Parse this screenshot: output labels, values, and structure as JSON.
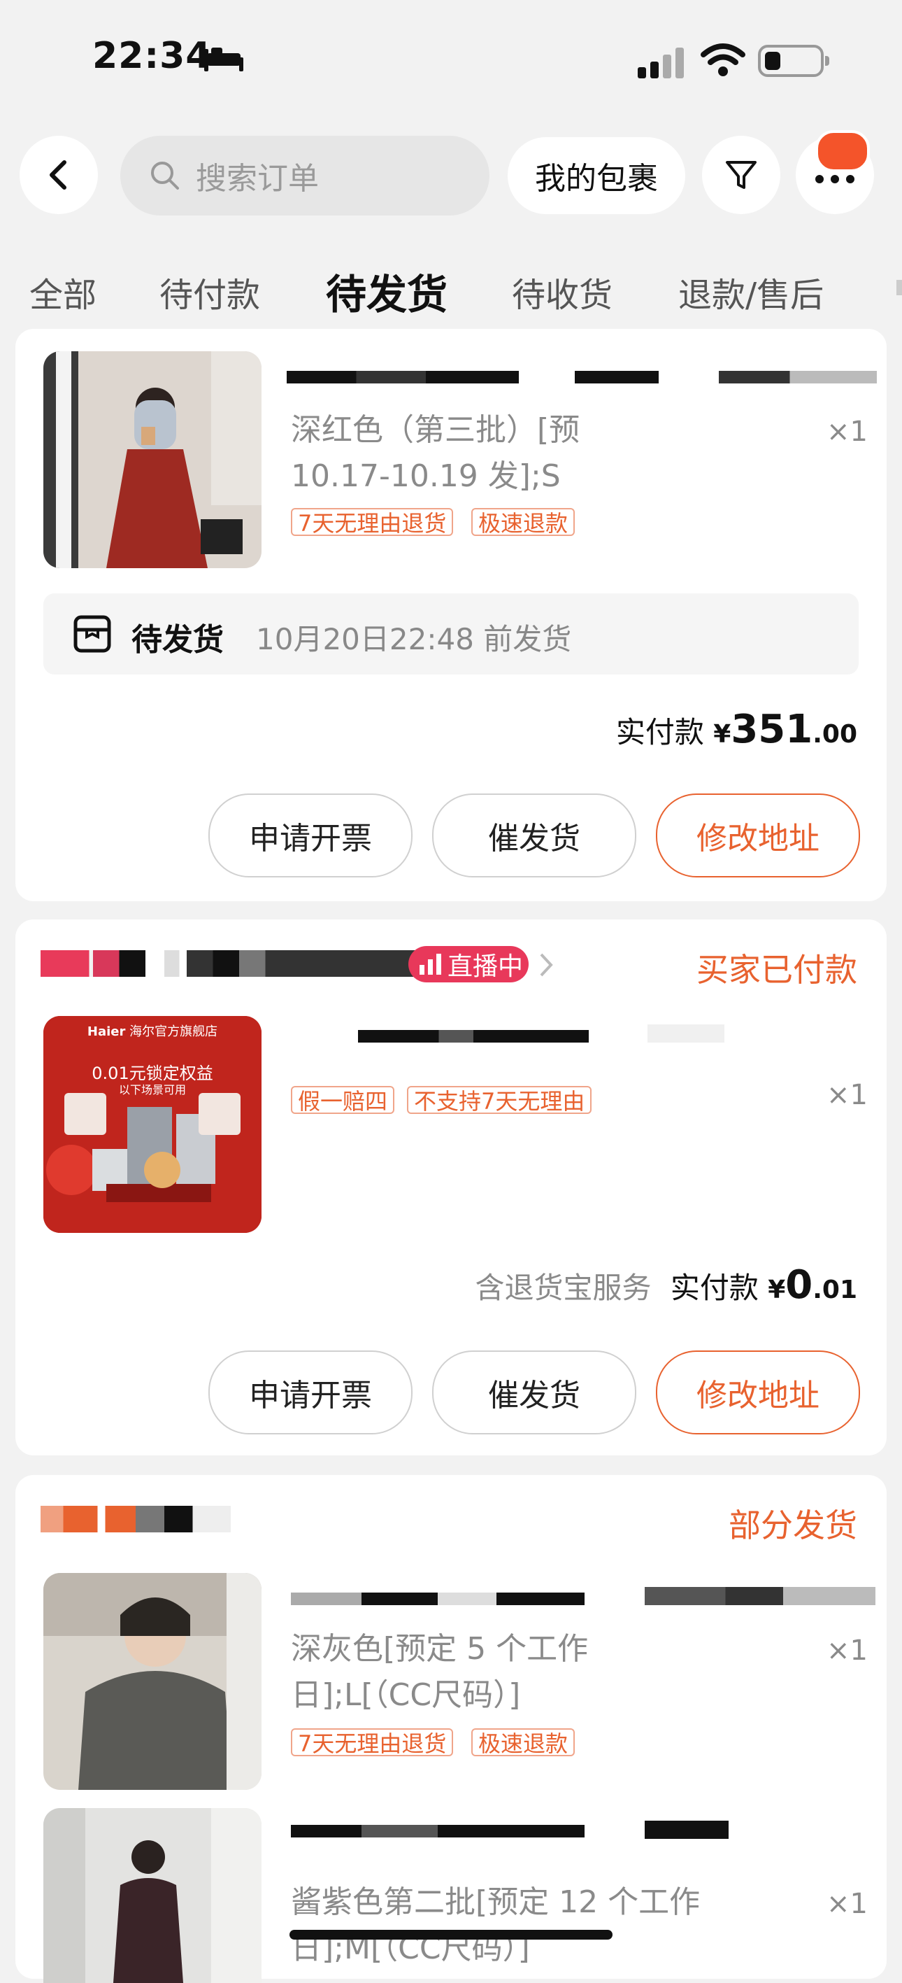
{
  "status_bar": {
    "time": "22:34"
  },
  "header": {
    "search_placeholder": "搜索订单",
    "packages_label": "我的包裹"
  },
  "tabs": [
    {
      "label": "全部"
    },
    {
      "label": "待付款"
    },
    {
      "label": "待发货",
      "active": true
    },
    {
      "label": "待收货"
    },
    {
      "label": "退款/售后"
    }
  ],
  "order1": {
    "variant_line1": "深红色（第三批）[预",
    "variant_line2": "10.17-10.19 发];S",
    "qty": "×1",
    "tags": [
      "7天无理由退货",
      "极速退款"
    ],
    "ship_status": "待发货",
    "ship_deadline": "10月20日22:48 前发货",
    "pay_label": "实付款",
    "currency": "¥",
    "pay_int": "351",
    "pay_dec": ".00",
    "buttons": [
      "申请开票",
      "催发货",
      "修改地址"
    ]
  },
  "order2": {
    "live_badge": "直播中",
    "status": "买家已付款",
    "qty": "×1",
    "tags": [
      "假一赔四",
      "不支持7天无理由"
    ],
    "thumb_brand": "Haier",
    "thumb_store": "海尔官方旗舰店",
    "thumb_headline": "0.01元锁定权益",
    "thumb_sub": "以下场景可用",
    "service_note": "含退货宝服务",
    "pay_label": "实付款",
    "currency": "¥",
    "pay_int": "0",
    "pay_dec": ".01",
    "buttons": [
      "申请开票",
      "催发货",
      "修改地址"
    ]
  },
  "order3": {
    "status": "部分发货",
    "item1": {
      "variant_line1": "深灰色[预定 5 个工作",
      "variant_line2": "日];L[（CC尺码）]",
      "qty": "×1",
      "tags": [
        "7天无理由退货",
        "极速退款"
      ]
    },
    "item2": {
      "variant_line1": "酱紫色第二批[预定 12 个工作",
      "variant_line2": "日];M[（CC尺码）]",
      "qty": "×1"
    }
  },
  "colors": {
    "accent": "#e8622f",
    "live": "#e8385a",
    "background": "#f2f2f2"
  }
}
